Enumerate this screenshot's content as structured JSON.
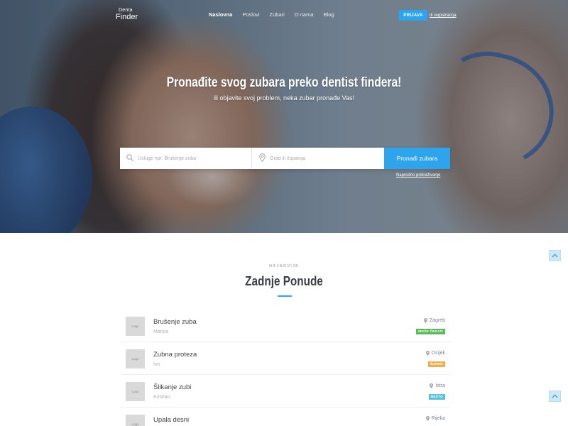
{
  "header": {
    "logo_small": "Denta",
    "logo_big": "Finder",
    "nav": [
      "Naslovna",
      "Poslovi",
      "Zubari",
      "O nama",
      "Blog"
    ],
    "active_nav": 0,
    "login_label": "PRIJAVA",
    "register_label": "ili registracija"
  },
  "hero": {
    "title": "Pronađite svog zubara preko dentist findera!",
    "subtitle": "ili objavite svoj problem, neka zubar pronađe Vas!",
    "search_placeholder": "Usluge npr. Brušenje zuba",
    "city_placeholder": "Grad ili županija",
    "search_button": "Pronađi zubara",
    "advanced_search": "Napredno pretraživanje"
  },
  "section": {
    "eyebrow": "NAJNOVIJE",
    "title": "Zadnje Ponude"
  },
  "offers": [
    {
      "logo": "Logo",
      "title": "Brušenje zuba",
      "author": "Marica",
      "location": "Zagreb",
      "badge": "MOŽE ČEKATI",
      "badge_color": "#5cb85c"
    },
    {
      "logo": "Logo",
      "title": "Zubna proteza",
      "author": "Ivo",
      "location": "Osijek",
      "badge": "ŽURNO",
      "badge_color": "#f0ad4e"
    },
    {
      "logo": "Logo",
      "title": "Šlikanje zubi",
      "author": "Kristian",
      "location": "Istra",
      "badge": "NEŠTO",
      "badge_color": "#5bc0de"
    },
    {
      "logo": "Logo",
      "title": "Upala desni",
      "author": "",
      "location": "Rijeka",
      "badge": "",
      "badge_color": "#5bc0de"
    }
  ],
  "colors": {
    "accent": "#2ea4ec"
  },
  "icons": {
    "search": "search-icon",
    "location": "map-pin-icon",
    "scroll_top": "chevron-up-icon"
  }
}
